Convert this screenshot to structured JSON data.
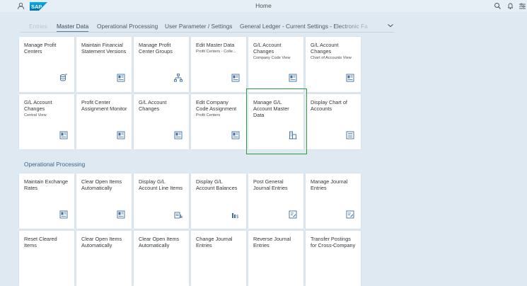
{
  "shell": {
    "logo_text": "SAP",
    "title": "Home",
    "icons": [
      "user-icon",
      "search-icon",
      "bell-icon",
      "settings-icon"
    ]
  },
  "anchors": [
    {
      "label": "Entries"
    },
    {
      "label": "Master Data"
    },
    {
      "label": "Operational Processing"
    },
    {
      "label": "User Parameter / Settings"
    },
    {
      "label": "General Ledger - Current Settings - Electronic Fa"
    }
  ],
  "master_data_tiles": [
    {
      "title": "Manage Profit Centers",
      "subtitle": "",
      "icon": "database-icon"
    },
    {
      "title": "Maintain Financial Statement Versions",
      "subtitle": "",
      "icon": "ledger-icon"
    },
    {
      "title": "Manage Profit Center Groups",
      "subtitle": "",
      "icon": "hierarchy-icon"
    },
    {
      "title": "Edit Master Data",
      "subtitle": "Profit Centers - Colle...",
      "icon": "ledger-icon"
    },
    {
      "title": "G/L Account Changes",
      "subtitle": "Company Code View",
      "icon": "ledger-icon"
    },
    {
      "title": "G/L Account Changes",
      "subtitle": "Chart of Accounts View",
      "icon": "ledger-icon"
    },
    {
      "title": "G/L Account Changes",
      "subtitle": "Central View",
      "icon": "ledger-icon"
    },
    {
      "title": "Profit Center Assignment Monitor",
      "subtitle": "",
      "icon": "ledger-icon"
    },
    {
      "title": "G/L Account Changes",
      "subtitle": "",
      "icon": "ledger-icon"
    },
    {
      "title": "Edit Company Code Assignment",
      "subtitle": "Profit Centers",
      "icon": "ledger-icon"
    },
    {
      "title": "Manage G/L Account Master Data",
      "subtitle": "",
      "icon": "building-icon"
    },
    {
      "title": "Display Chart of Accounts",
      "subtitle": "",
      "icon": "list-icon"
    }
  ],
  "operational": {
    "section_title": "Operational Processing",
    "tiles": [
      {
        "title": "Maintain Exchange Rates",
        "subtitle": "",
        "icon": "ledger-icon"
      },
      {
        "title": "Clear Open Items Automatically",
        "subtitle": "",
        "icon": "ledger-icon"
      },
      {
        "title": "Display G/L Account Line Items",
        "subtitle": "",
        "icon": "line-items-icon"
      },
      {
        "title": "Display G/L Account Balances",
        "subtitle": "",
        "icon": "balance-icon"
      },
      {
        "title": "Post General Journal Entries",
        "subtitle": "",
        "icon": "post-icon"
      },
      {
        "title": "Manage Journal Entries",
        "subtitle": "",
        "icon": "post-icon"
      },
      {
        "title": "Reset Cleared Items",
        "subtitle": "",
        "icon": "ledger-icon"
      },
      {
        "title": "Clear Open Items Automatically",
        "subtitle": "",
        "icon": "ledger-icon"
      },
      {
        "title": "Clear Open Items Automatically",
        "subtitle": "",
        "icon": "ledger-icon"
      },
      {
        "title": "Change Journal Entries",
        "subtitle": "",
        "icon": "ledger-icon"
      },
      {
        "title": "Reverse Journal Entries",
        "subtitle": "",
        "icon": "ledger-icon"
      },
      {
        "title": "Transfer Postings for Cross-Company",
        "subtitle": "",
        "icon": "ledger-icon"
      }
    ]
  }
}
